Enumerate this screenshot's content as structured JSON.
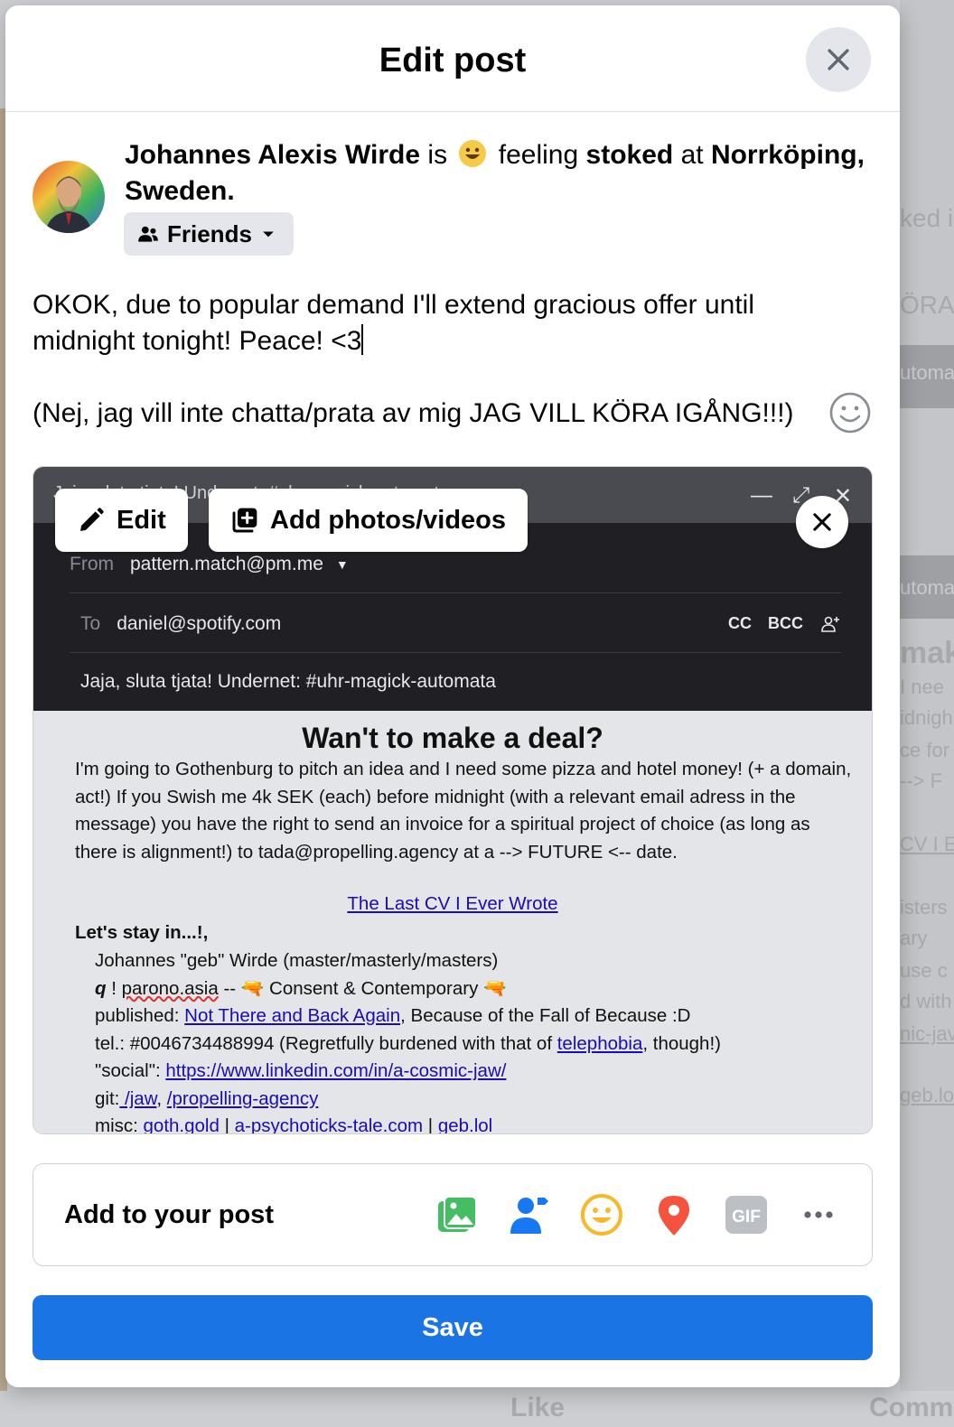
{
  "background": {
    "right_snippets": [
      "ked i",
      "ÖRA",
      "utoma",
      "utoma",
      "mak",
      "I nee",
      "idnigh",
      "ce for",
      "--> F",
      "CV I E",
      "isters",
      "ary",
      "use c",
      "d with",
      "nic-jav",
      "geb.lol"
    ],
    "bottom_like_label": "Like",
    "bottom_comment_label": "Comm"
  },
  "modal": {
    "title": "Edit post",
    "close_icon": "close-icon"
  },
  "author": {
    "name": "Johannes Alexis Wirde",
    "is_text": "is",
    "feeling_text": "feeling",
    "feeling": "stoked",
    "at_text": "at",
    "location": "Norrköping, Sweden.",
    "audience": "Friends"
  },
  "post": {
    "line1": "OKOK, due to popular demand I'll extend gracious offer until midnight tonight! Peace! <3",
    "line2": "(Nej, jag vill inte chatta/prata av mig JAG VILL KÖRA IGÅNG!!!)"
  },
  "attachment": {
    "edit_label": "Edit",
    "add_media_label": "Add photos/videos",
    "email": {
      "subject_ghost": "Jaja, sluta tjata! Undernet: #uhr-magick-automata",
      "from_label": "From",
      "from_value": "pattern.match@pm.me",
      "to_label": "To",
      "to_value": "daniel@spotify.com",
      "cc_label": "CC",
      "bcc_label": "BCC",
      "subject": "Jaja, sluta tjata! Undernet: #uhr-magick-automata",
      "heading": "Wan't to make a deal?",
      "body": "I'm going to Gothenburg to pitch an idea and I need some pizza and hotel money! (+ a domain, act!) If you Swish me 4k SEK (each) before midnight (with a relevant email adress in the message) you have the right to send an invoice for a spiritual project of choice (as long as there is alignment!) to tada@propelling.agency at a --> FUTURE <-- date.",
      "center_link": "The Last CV I Ever Wrote",
      "sig_title": "Let's stay in...!,",
      "sig_line1": "Johannes \"geb\" Wirde (master/masterly/masters)",
      "sig_q": "q",
      "sig_line2_a": " ! ",
      "sig_line2_site": "parono.asia",
      "sig_line2_b": " -- 🔫 Consent & Contemporary 🔫",
      "sig_pub_label": "published: ",
      "sig_pub_link": "Not There and Back Again",
      "sig_pub_rest": ", Because of the Fall of Because :D",
      "sig_tel": "tel.: #0046734488994 (Regretfully burdened with that of ",
      "sig_tel_link": "telephobia",
      "sig_tel_end": ", though!)",
      "sig_social_label": "\"social\": ",
      "sig_social_link": "https://www.linkedin.com/in/a-cosmic-jaw/",
      "sig_git_label": "git:",
      "sig_git_link1": " /jaw",
      "sig_git_sep": ", ",
      "sig_git_link2": "/propelling-agency",
      "sig_misc_label": "misc: ",
      "sig_misc_link1": "goth.gold",
      "sig_misc_sep1": " | ",
      "sig_misc_link2": "a-psychoticks-tale.com",
      "sig_misc_sep2": " | ",
      "sig_misc_link3": "geb.lol"
    }
  },
  "add_to_post": {
    "label": "Add to your post",
    "icons": [
      "photo-video-icon",
      "tag-people-icon",
      "feeling-icon",
      "check-in-icon",
      "gif-icon",
      "more-icon"
    ]
  },
  "save_label": "Save",
  "colors": {
    "primary": "#1b74e4",
    "link": "#1a0dab",
    "photo_green": "#45bd62",
    "tag_blue": "#1877f2",
    "feeling_yellow": "#f7b928",
    "checkin_red": "#f5533d",
    "gif_gray": "#bcc0c4"
  }
}
